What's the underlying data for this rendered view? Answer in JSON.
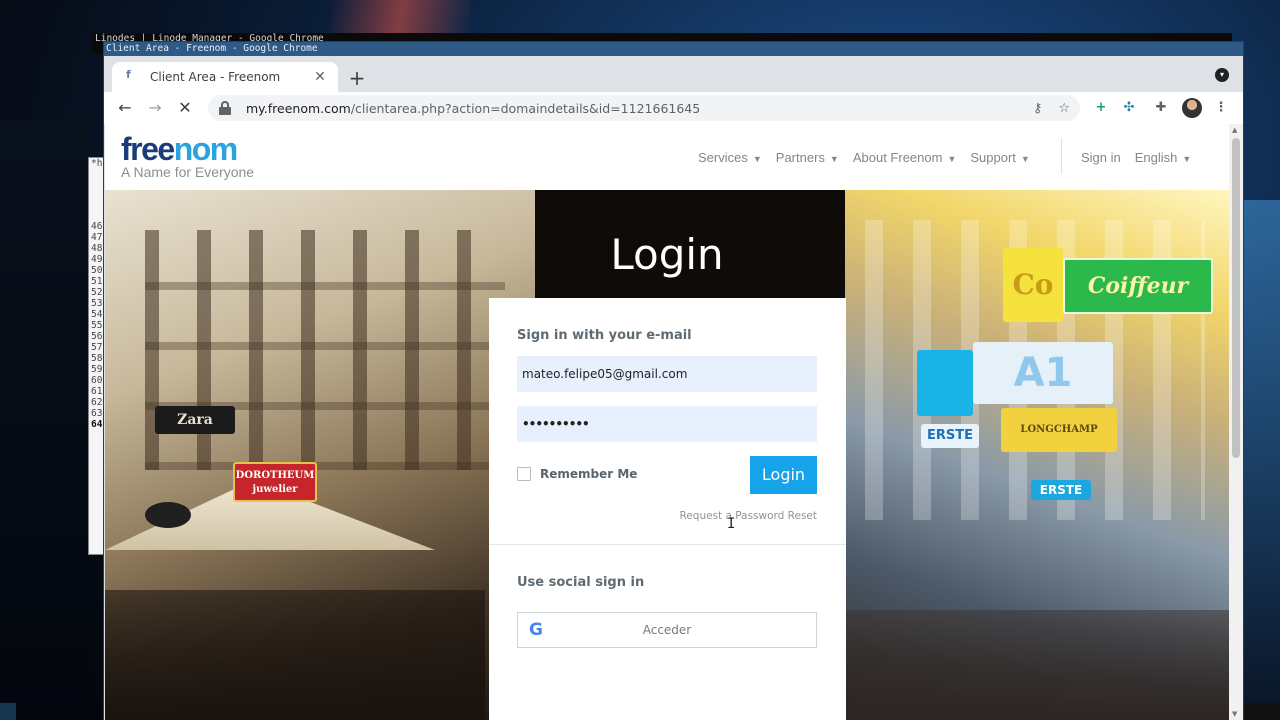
{
  "background_windows": {
    "title_line1": "Linodes | Linode Manager - Google Chrome",
    "title_line2": "Client Area - Freenom - Google Chrome",
    "terminal_header": "*hy",
    "terminal_lines": [
      "46",
      "47",
      "48",
      "49",
      "50",
      "51",
      "52",
      "53",
      "54",
      "55",
      "56",
      "57",
      "58",
      "59",
      "60",
      "61",
      "62",
      "63",
      "64"
    ]
  },
  "browser": {
    "window_title": "Client Area - Freenom - Google Chrome",
    "tab": {
      "title": "Client Area - Freenom",
      "close": "✕",
      "favicon": "freenom-favicon"
    },
    "new_tab": "+",
    "url_host": "my.freenom.com",
    "url_path": "/clientarea.php?action=domaindetails&id=1121661645",
    "nav": {
      "back": "←",
      "forward": "→",
      "stop": "✕"
    },
    "omnibox_icons": [
      "key-icon",
      "star-icon"
    ],
    "extensions": [
      "plus-extension-icon",
      "network-extension-icon",
      "puzzle-icon",
      "avatar",
      "menu-icon"
    ]
  },
  "site": {
    "logo": {
      "word_a": "free",
      "word_b": "nom",
      "tagline": "A Name for Everyone"
    },
    "nav": [
      {
        "label": "Services"
      },
      {
        "label": "Partners"
      },
      {
        "label": "About Freenom"
      },
      {
        "label": "Support"
      }
    ],
    "nav_right": [
      {
        "label": "Sign in"
      },
      {
        "label": "English"
      }
    ],
    "colors": {
      "logo_dark": "#1b3c78",
      "logo_light": "#2aa3e0",
      "login_button": "#15a3ea",
      "field_bg": "#e8f0fe"
    }
  },
  "hero": {
    "title": "Login",
    "signs": {
      "dorotheum": "DOROTHEUM juwelier",
      "coiffeur": "Coiffeur",
      "co": "Co",
      "erste": "ERSTE",
      "erste2": "ERSTE",
      "a1": "A1",
      "zara": "Zara",
      "longchamp": "LONGCHAMP"
    }
  },
  "login_form": {
    "email_heading": "Sign in with your e-mail",
    "email_value": "mateo.felipe05@gmail.com",
    "password_value": "••••••••••",
    "remember_label": "Remember Me",
    "remember_checked": false,
    "login_button": "Login",
    "reset_link": "Request a Password Reset",
    "social_heading": "Use social sign in",
    "google_button": "Acceder"
  }
}
